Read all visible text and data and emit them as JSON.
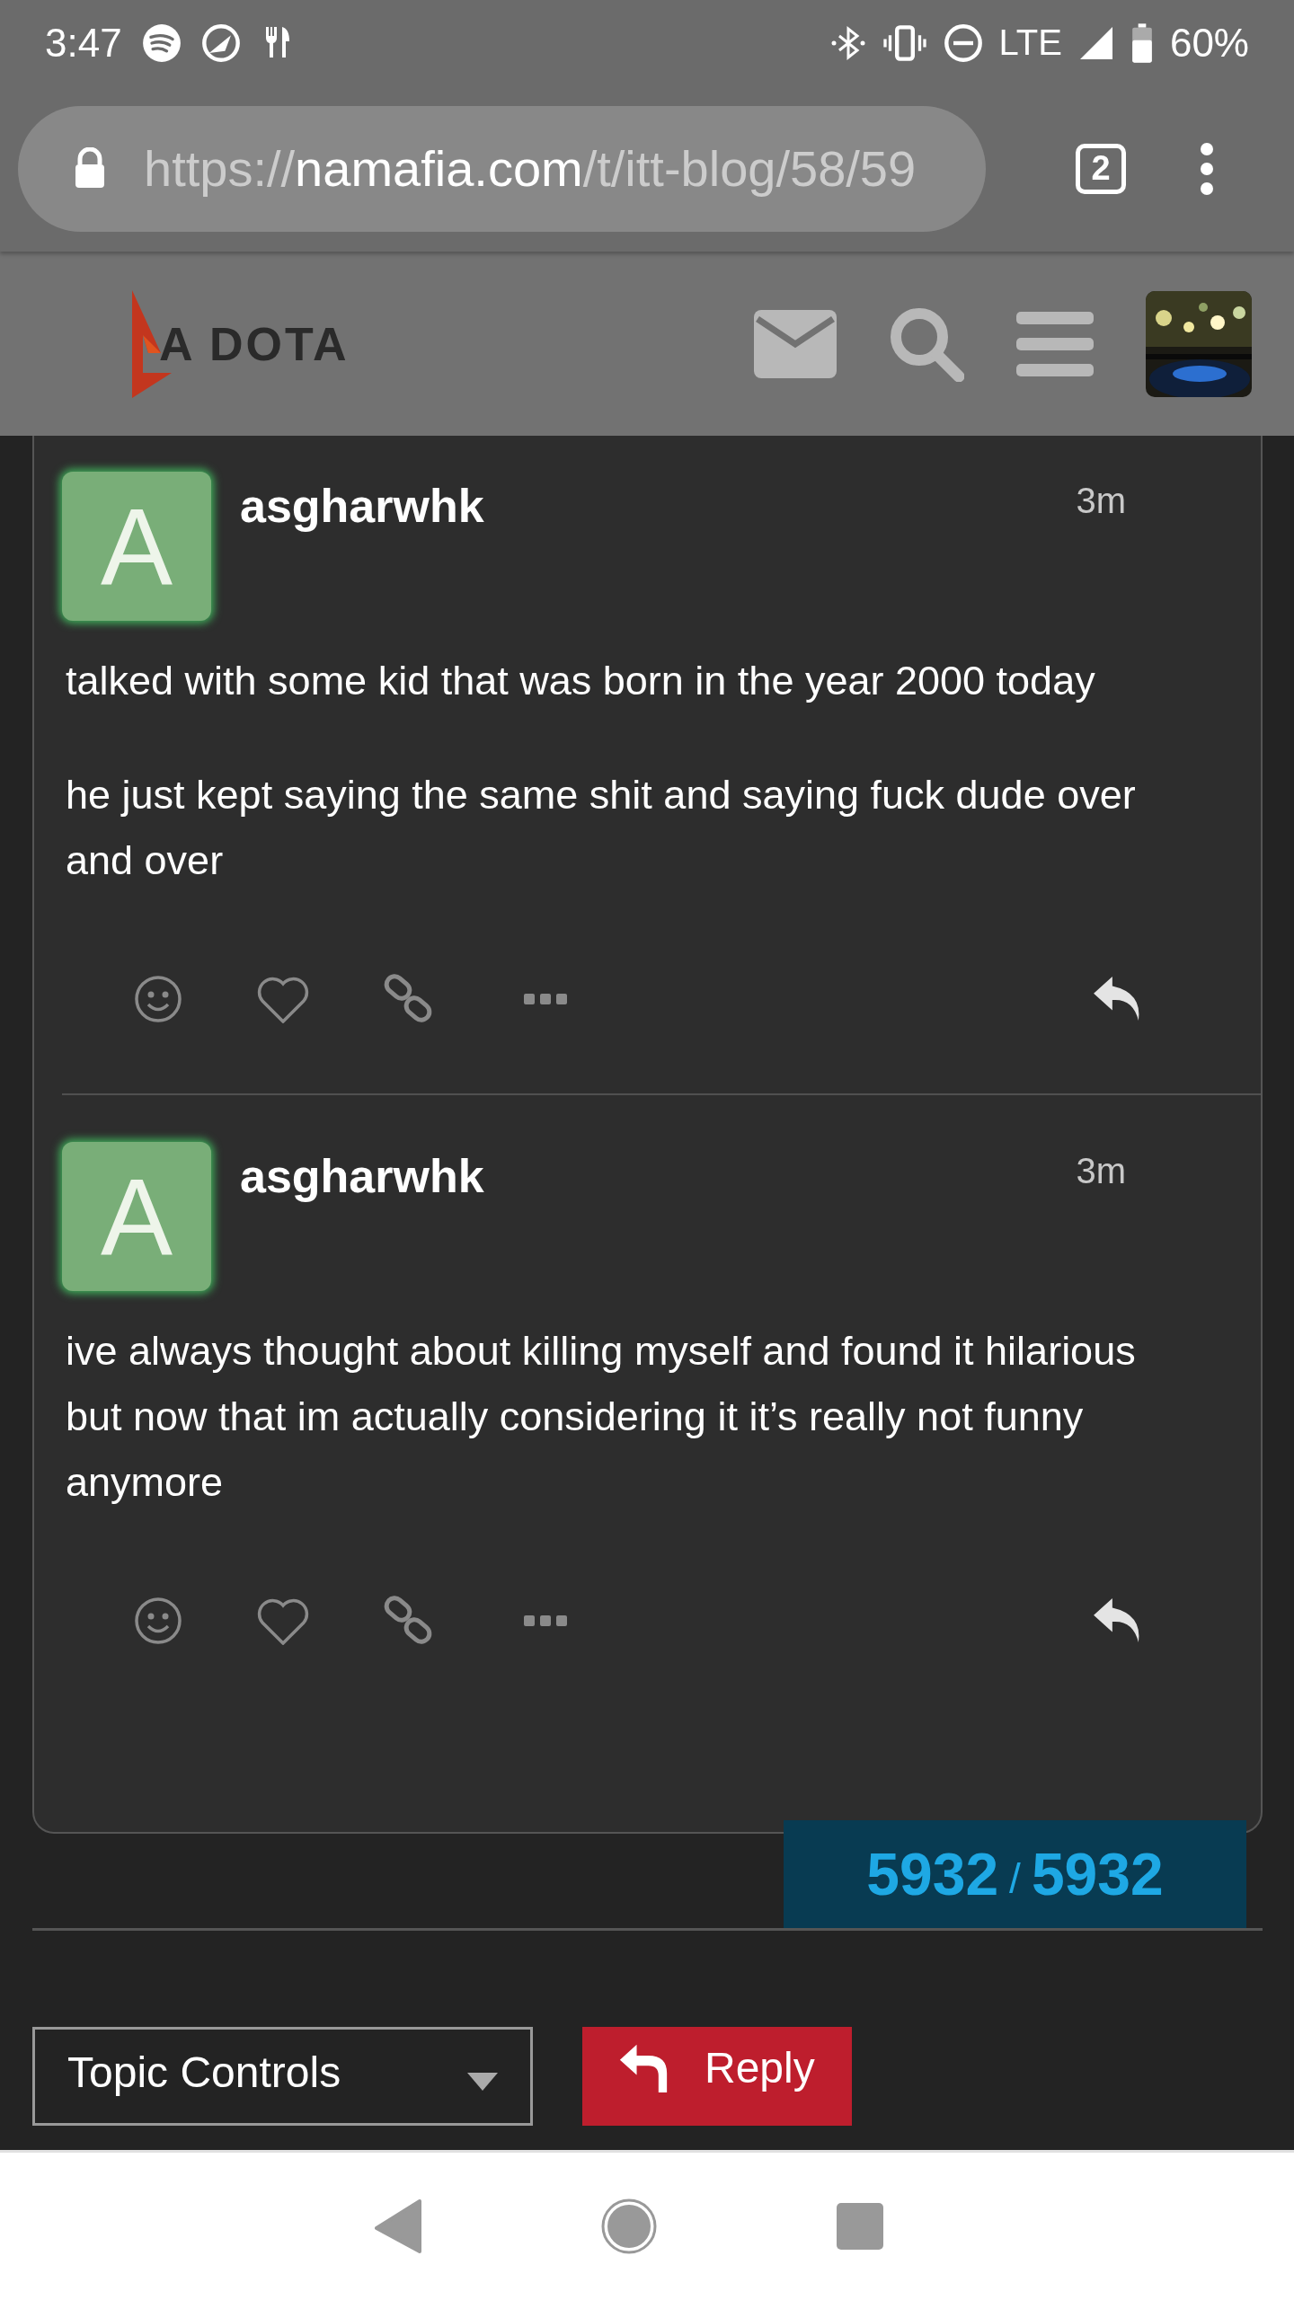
{
  "status_bar": {
    "time": "3:47",
    "network": "LTE",
    "battery": "60%"
  },
  "browser": {
    "url_scheme": "https://",
    "url_host": "namafia.com",
    "url_path": "/t/itt-blog/58/59",
    "tab_count": "2"
  },
  "site_header": {
    "logo_text": "A DOTA"
  },
  "posts": [
    {
      "avatar_letter": "A",
      "author": "asgharwhk",
      "time": "3m",
      "paragraphs": [
        "talked with some kid that was born in the year 2000 today",
        "he just kept saying the same shit and saying fuck dude over and over"
      ]
    },
    {
      "avatar_letter": "A",
      "author": "asgharwhk",
      "time": "3m",
      "paragraphs": [
        "ive always thought about killing myself and found it hilarious but now that im actually considering it it’s really not funny anymore"
      ]
    }
  ],
  "progress": {
    "current": "5932",
    "separator": "/",
    "total": "5932"
  },
  "footer": {
    "topic_controls": "Topic Controls",
    "reply": "Reply"
  }
}
